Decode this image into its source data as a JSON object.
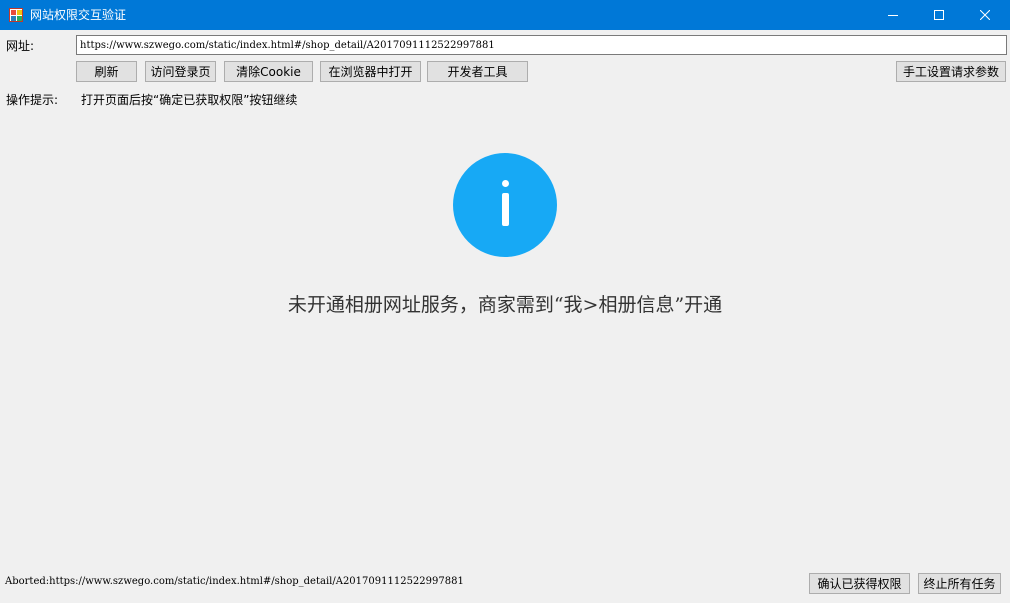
{
  "window": {
    "title": "网站权限交互验证",
    "controls": [
      "minimize-icon",
      "maximize-icon",
      "close-icon"
    ]
  },
  "url_bar": {
    "label": "网址:",
    "value": "https://www.szwego.com/static/index.html#/shop_detail/A2017091112522997881"
  },
  "toolbar": {
    "refresh": "刷新",
    "visit_login": "访问登录页",
    "clear_cookie": "清除Cookie",
    "open_in_browser": "在浏览器中打开",
    "dev_tools": "开发者工具",
    "manual_params": "手工设置请求参数"
  },
  "hint": {
    "label": "操作提示:",
    "text": "打开页面后按“确定已获取权限”按钮继续"
  },
  "page": {
    "icon": "info-icon",
    "icon_color": "#17a9f5",
    "message": "未开通相册网址服务，商家需到“我>相册信息”开通"
  },
  "status": {
    "text": "Aborted:https://www.szwego.com/static/index.html#/shop_detail/A2017091112522997881"
  },
  "bottom_buttons": {
    "confirm": "确认已获得权限",
    "stop_all": "终止所有任务"
  },
  "colors": {
    "titlebar": "#0078d7",
    "background": "#f0f0f0"
  }
}
